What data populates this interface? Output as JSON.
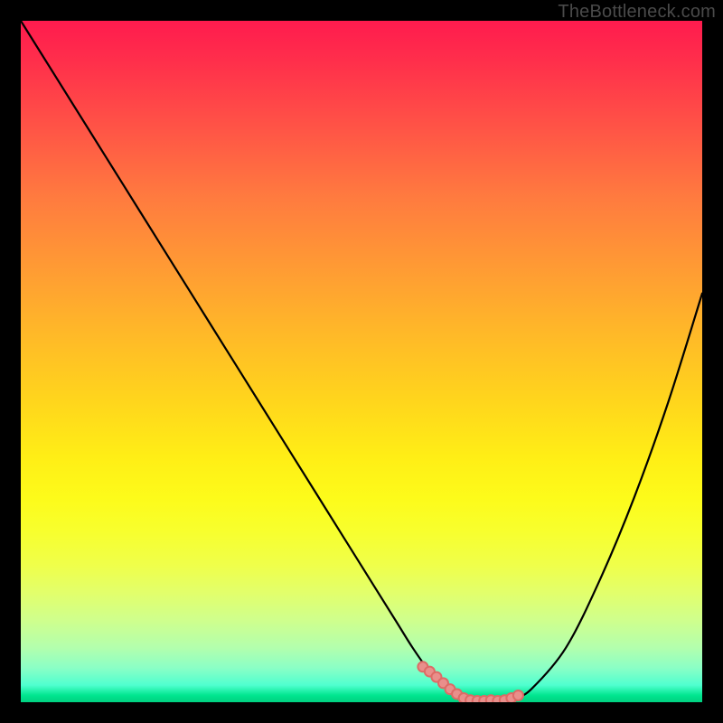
{
  "watermark": "TheBottleneck.com",
  "colors": {
    "frame": "#000000",
    "curve_stroke": "#000000",
    "marker_stroke": "#dd6b66",
    "marker_fill": "#e98f8b"
  },
  "chart_data": {
    "type": "line",
    "title": "",
    "xlabel": "",
    "ylabel": "",
    "xlim": [
      0,
      100
    ],
    "ylim": [
      0,
      100
    ],
    "x": [
      0,
      5,
      10,
      15,
      20,
      25,
      30,
      35,
      40,
      45,
      50,
      55,
      57.5,
      60,
      62.5,
      65,
      67.5,
      70,
      72.5,
      75,
      80,
      85,
      90,
      95,
      100
    ],
    "y": [
      100,
      92,
      84,
      76,
      68,
      60,
      52,
      44,
      36,
      28,
      20,
      12,
      8,
      4.5,
      2,
      0.6,
      0.2,
      0.2,
      0.6,
      2,
      8,
      18,
      30,
      44,
      60
    ],
    "highlight": {
      "x": [
        59,
        60,
        61,
        62,
        63,
        64,
        65,
        66,
        67,
        68,
        69,
        70,
        71,
        72,
        73
      ],
      "y": [
        5.2,
        4.5,
        3.7,
        2.8,
        1.9,
        1.2,
        0.6,
        0.3,
        0.2,
        0.2,
        0.3,
        0.2,
        0.3,
        0.6,
        1.0
      ]
    }
  }
}
